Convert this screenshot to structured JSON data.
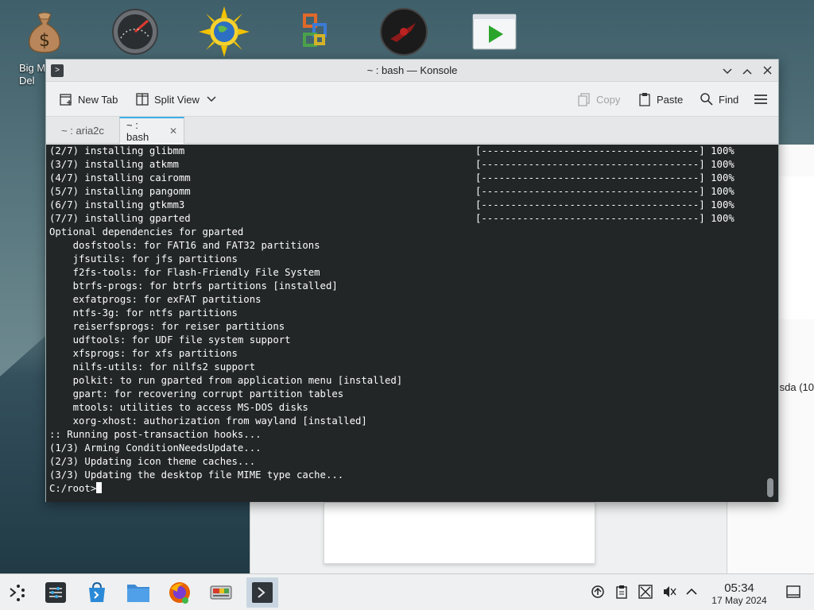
{
  "desktop": {
    "icon_label": "Big M\nDel"
  },
  "background_window": {
    "partial_text": "sda (10"
  },
  "konsole": {
    "title": "~ : bash — Konsole",
    "toolbar": {
      "new_tab": "New Tab",
      "split_view": "Split View",
      "copy": "Copy",
      "paste": "Paste",
      "find": "Find"
    },
    "tabs": [
      {
        "label": "~ : aria2c"
      },
      {
        "label": "~ : bash"
      }
    ],
    "terminal_lines": [
      "(2/7) installing glibmm",
      "(3/7) installing atkmm",
      "(4/7) installing cairomm",
      "(5/7) installing pangomm",
      "(6/7) installing gtkmm3",
      "(7/7) installing gparted",
      "Optional dependencies for gparted",
      "    dosfstools: for FAT16 and FAT32 partitions",
      "    jfsutils: for jfs partitions",
      "    f2fs-tools: for Flash-Friendly File System",
      "    btrfs-progs: for btrfs partitions [installed]",
      "    exfatprogs: for exFAT partitions",
      "    ntfs-3g: for ntfs partitions",
      "    reiserfsprogs: for reiser partitions",
      "    udftools: for UDF file system support",
      "    xfsprogs: for xfs partitions",
      "    nilfs-utils: for nilfs2 support",
      "    polkit: to run gparted from application menu [installed]",
      "    gpart: for recovering corrupt partition tables",
      "    mtools: utilities to access MS-DOS disks",
      "    xorg-xhost: authorization from wayland [installed]",
      ":: Running post-transaction hooks...",
      "(1/3) Arming ConditionNeedsUpdate...",
      "(2/3) Updating icon theme caches...",
      "(3/3) Updating the desktop file MIME type cache..."
    ],
    "progress_lines": [
      "[-------------------------------------] 100%",
      "[-------------------------------------] 100%",
      "[-------------------------------------] 100%",
      "[-------------------------------------] 100%",
      "[-------------------------------------] 100%",
      "[-------------------------------------] 100%"
    ],
    "prompt": "C:/root>"
  },
  "taskbar": {
    "time": "05:34",
    "date": "17 May 2024"
  },
  "colors": {
    "terminal_bg": "#232627",
    "terminal_fg": "#fcfcfc",
    "accent": "#3daee9",
    "panel_bg": "#eff0f1"
  }
}
